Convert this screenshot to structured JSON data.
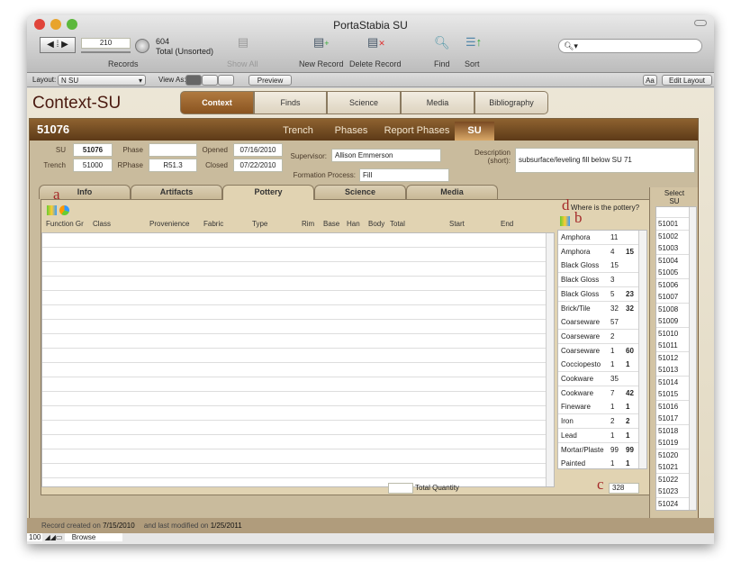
{
  "window": {
    "title": "PortaStabia SU"
  },
  "toolbar": {
    "record_number": "210",
    "found_count": "604",
    "sort_state": "Total (Unsorted)",
    "records_label": "Records",
    "show_all": "Show All",
    "new_record": "New Record",
    "delete_record": "Delete Record",
    "find": "Find",
    "sort": "Sort",
    "search_placeholder": ""
  },
  "layoutbar": {
    "layout_label": "Layout:",
    "layout_value": "N SU",
    "view_as_label": "View As:",
    "preview": "Preview",
    "text_size": "Aa",
    "edit_layout": "Edit Layout"
  },
  "header": {
    "app_title": "Context-SU",
    "tabs": [
      "Context",
      "Finds",
      "Science",
      "Media",
      "Bibliography"
    ],
    "active_tab": "Context"
  },
  "record": {
    "id": "51076",
    "subtabs": [
      "Trench",
      "Phases",
      "Report Phases",
      "SU"
    ],
    "active_subtab": "SU"
  },
  "form": {
    "su_label": "SU",
    "su": "51076",
    "trench_label": "Trench",
    "trench": "51000",
    "phase_label": "Phase",
    "phase": "",
    "rphase_label": "RPhase",
    "rphase": "R51.3",
    "opened_label": "Opened",
    "opened": "07/16/2010",
    "closed_label": "Closed",
    "closed": "07/22/2010",
    "supervisor_label": "Supervisor:",
    "supervisor": "Allison Emmerson",
    "formation_label": "Formation Process:",
    "formation": "Fill",
    "description_label": "Description",
    "description_label2": "(short):",
    "description": "subsurface/leveling fill below SU 71"
  },
  "pottery": {
    "tabs": [
      "Info",
      "Artifacts",
      "Pottery",
      "Science",
      "Media"
    ],
    "active_tab": "Pottery",
    "annotations": {
      "a": "a",
      "b": "b",
      "c": "c",
      "d": "d"
    },
    "where_label": "Where is the pottery?",
    "columns": [
      "Function Gr",
      "Class",
      "Provenience",
      "Fabric",
      "Type",
      "Rim",
      "Base",
      "Han",
      "Body",
      "Total",
      "Start",
      "End"
    ],
    "total_quantity_label": "Total Quantity",
    "total_quantity": "",
    "summary_total": "328",
    "summary": [
      [
        "Amphora",
        "11",
        ""
      ],
      [
        "Amphora",
        "4",
        "15"
      ],
      [
        "Black Gloss",
        "15",
        ""
      ],
      [
        "Black Gloss",
        "3",
        ""
      ],
      [
        "Black Gloss",
        "5",
        "23"
      ],
      [
        "Brick/Tile",
        "32",
        "32"
      ],
      [
        "Coarseware",
        "57",
        ""
      ],
      [
        "Coarseware",
        "2",
        ""
      ],
      [
        "Coarseware",
        "1",
        "60"
      ],
      [
        "Cocciopesto",
        "1",
        "1"
      ],
      [
        "Cookware",
        "35",
        ""
      ],
      [
        "Cookware",
        "7",
        "42"
      ],
      [
        "Fineware",
        "1",
        "1"
      ],
      [
        "Iron",
        "2",
        "2"
      ],
      [
        "Lead",
        "1",
        "1"
      ],
      [
        "Mortar/Plaste",
        "99",
        "99"
      ],
      [
        "Painted",
        "1",
        "1"
      ]
    ]
  },
  "select_su": {
    "label1": "Select",
    "label2": "SU",
    "items": [
      "51001",
      "51002",
      "51003",
      "51004",
      "51005",
      "51006",
      "51007",
      "51008",
      "51009",
      "51010",
      "51011",
      "51012",
      "51013",
      "51014",
      "51015",
      "51016",
      "51017",
      "51018",
      "51019",
      "51020",
      "51021",
      "51022",
      "51023",
      "51024"
    ]
  },
  "status": {
    "created_label": "Record created on",
    "created": "7/15/2010",
    "modified_label": "and last modified on",
    "modified": "1/25/2011"
  },
  "bottombar": {
    "zoom": "100",
    "mode": "Browse"
  },
  "colors": {
    "brown_bar": "#6e4620",
    "active_tab": "#9a6430",
    "panel": "#c9bb9d",
    "annotation": "#a52a2a"
  }
}
